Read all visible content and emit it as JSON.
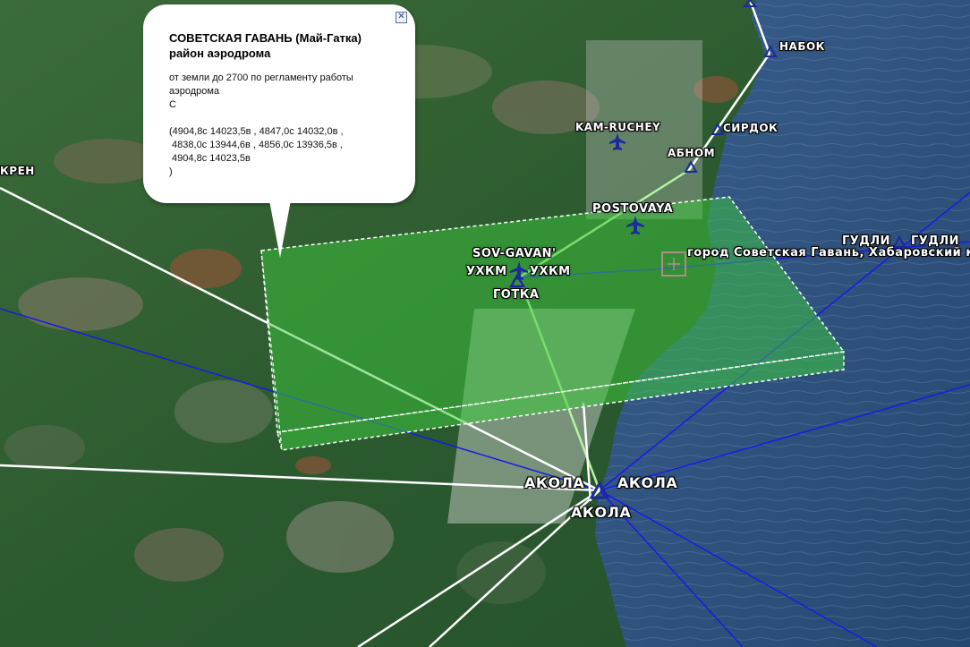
{
  "popup": {
    "title_line1": "СОВЕТСКАЯ ГАВАНЬ (Май-Гатка)",
    "title_line2": "район аэродрома",
    "limits": "от земли до 2700 по регламенту работы аэродрома",
    "class": "С",
    "coords_line1": "(4904,8с 14023,5в , 4847,0с 14032,0в ,",
    "coords_line2": " 4838,0с 13944,6в , 4856,0с 13936,5в ,",
    "coords_line3": " 4904,8с 14023,5в",
    "coords_close": ")",
    "close_icon": "close-icon"
  },
  "labels": {
    "kren": "КРЕН",
    "nabok": "НАБОК",
    "kam_ruchey": "KAM-RUCHEY",
    "sirdok": "СИРДОК",
    "abnom": "АБНОМ",
    "postovaya": "POSTOVAYA",
    "sov_gavan": "SOV-GAVAN'",
    "uhkm_left": "УХКМ",
    "uhkm_right": "УХКМ",
    "gotka": "ГОТКА",
    "city": "город Советская Гавань, Хабаровский к",
    "gudli_1": "ГУДЛИ",
    "gudli_2": "ГУДЛИ",
    "akola_left": "АКОЛА",
    "akola_right": "АКОЛА",
    "akola_bottom": "АКОЛА"
  },
  "colors": {
    "zone_fill": "#3cc83c",
    "route_white": "#ffffff",
    "route_blue": "#1a1ae6",
    "route_lightgreen": "#b6f3a0",
    "aircraft_blue": "#1c2a9c",
    "sea": "#2d4f7f",
    "land": "#2f5a2e"
  }
}
